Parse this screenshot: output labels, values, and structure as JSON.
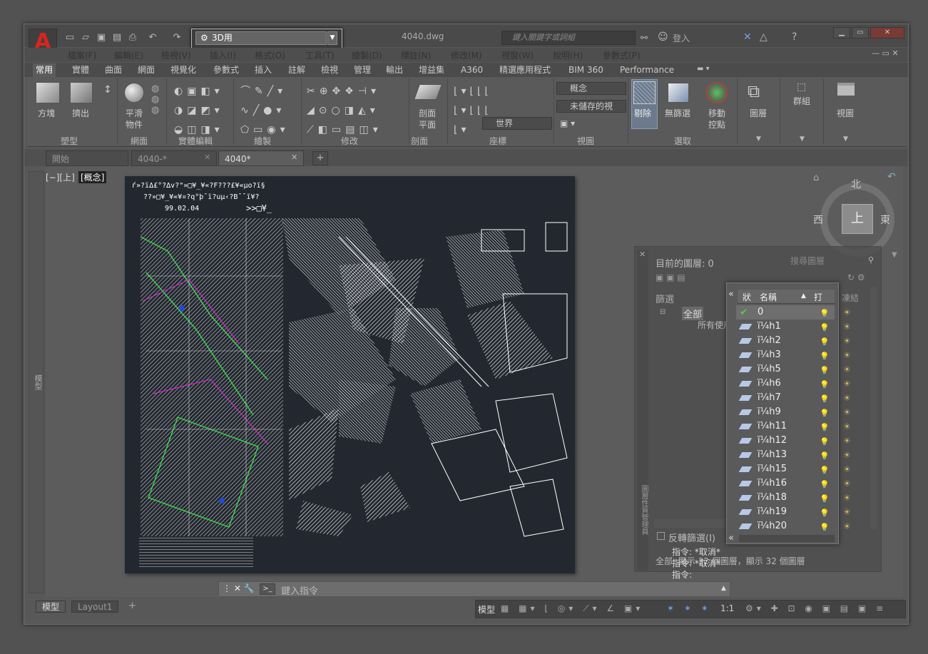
{
  "app": {
    "title": "4040.dwg",
    "logo": "A",
    "logo_color": "#d4261f"
  },
  "workspace": {
    "value": "3D用"
  },
  "search": {
    "placeholder": "鍵入關鍵字或詞組"
  },
  "account": {
    "login": "登入"
  },
  "menus": [
    "檔案(F)",
    "編輯(E)",
    "檢視(V)",
    "插入(I)",
    "格式(O)",
    "工具(T)",
    "繪製(D)",
    "標註(N)",
    "修改(M)",
    "視窗(W)",
    "說明(H)",
    "參數式(P)"
  ],
  "ribbon_tabs": [
    "常用",
    "實體",
    "曲面",
    "網面",
    "視覺化",
    "參數式",
    "插入",
    "註解",
    "檢視",
    "管理",
    "輸出",
    "增益集",
    "A360",
    "精選應用程式",
    "BIM 360",
    "Performance"
  ],
  "ribbon": {
    "box": "方塊",
    "extrude": "擠出",
    "smooth1": "平滑",
    "smooth2": "物件",
    "section1": "剖面",
    "section2": "平面",
    "visual_style": "概念",
    "view_unsaved": "未儲存的視",
    "ucs": "世界",
    "cull": "剔除",
    "no_filter": "無篩選",
    "gizmo1": "移動",
    "gizmo2": "控點",
    "layers": "圖層",
    "groups": "群組",
    "view": "視圖",
    "panels": [
      "塑型",
      "網面",
      "實體編輯",
      "繪製",
      "修改",
      "剖面",
      "座標",
      "視圖",
      "選取"
    ]
  },
  "doc_tabs": [
    "開始",
    "4040-*",
    "4040*"
  ],
  "viewport": {
    "label_prefix": "[−][上]",
    "label_style": "[概念]"
  },
  "drawing": {
    "header1": "ѓ»?ï∆£°?∆v?\"»□¥_¥«?F???£¥«µo?ï§",
    "header2": "??»□¥_¥«¥¤?q°þ¯ï?uµ‹?B¯¯ï¥?",
    "date": "99.02.04",
    "mark": ">>□¥_"
  },
  "viewcube": {
    "north": "北",
    "south": "",
    "east": "東",
    "west": "西",
    "top": "上"
  },
  "layer_palette": {
    "current": "目前的圖層: 0",
    "search": "搜尋圖層",
    "filters": "篩選",
    "all": "全部",
    "all_used": "所有使用",
    "invert": "反轉篩選(I)",
    "status_col": "狀",
    "name_col": "名稱",
    "on_col": "打",
    "freeze_col": "凍結",
    "summary": "全部: 顯示 32 個圖層，顯示 32 個圖層",
    "side_label": "圖層性質管理員"
  },
  "layers": [
    {
      "name": "0",
      "current": true
    },
    {
      "name": "ï¼h1"
    },
    {
      "name": "ï¼h2"
    },
    {
      "name": "ï¼h3"
    },
    {
      "name": "ï¼h5"
    },
    {
      "name": "ï¼h6"
    },
    {
      "name": "ï¼h7"
    },
    {
      "name": "ï¼h9"
    },
    {
      "name": "ï¼h11"
    },
    {
      "name": "ï¼h12"
    },
    {
      "name": "ï¼h13"
    },
    {
      "name": "ï¼h15"
    },
    {
      "name": "ï¼h16"
    },
    {
      "name": "ï¼h18"
    },
    {
      "name": "ï¼h19"
    },
    {
      "name": "ï¼h20"
    }
  ],
  "command": {
    "placeholder": "鍵入指令",
    "history": [
      "指令: *取消*",
      "指令: *取消*",
      "指令:"
    ]
  },
  "layout_tabs": [
    "模型",
    "Layout1"
  ],
  "status": {
    "model": "模型",
    "scale": "1:1"
  },
  "left_strip": "模型"
}
